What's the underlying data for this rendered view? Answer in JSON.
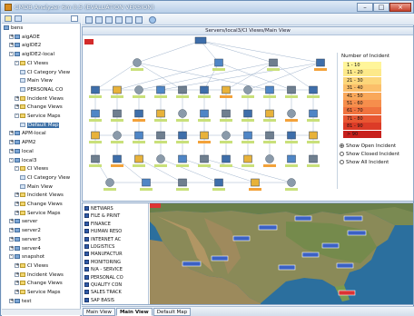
{
  "window": {
    "title": "CMDB Analyzer 6m 0.5 (EVALUATION VERSION)"
  },
  "tree": {
    "items": [
      {
        "label": "bens",
        "level": 0,
        "icon": "db",
        "expander": ""
      },
      {
        "label": "aigADE",
        "level": 1,
        "icon": "db",
        "expander": "+"
      },
      {
        "label": "aigIDE2",
        "level": 1,
        "icon": "db",
        "expander": "+"
      },
      {
        "label": "aigIDE2-local",
        "level": 1,
        "icon": "db",
        "expander": "-"
      },
      {
        "label": "CI Views",
        "level": 2,
        "icon": "fold",
        "expander": "-"
      },
      {
        "label": "CI Category View",
        "level": 3,
        "icon": "view",
        "expander": ""
      },
      {
        "label": "Main View",
        "level": 3,
        "icon": "view",
        "expander": ""
      },
      {
        "label": "PERSONAL CO",
        "level": 3,
        "icon": "view",
        "expander": ""
      },
      {
        "label": "Incident Views",
        "level": 2,
        "icon": "fold",
        "expander": "+"
      },
      {
        "label": "Change Views",
        "level": 2,
        "icon": "fold",
        "expander": "+"
      },
      {
        "label": "Service Maps",
        "level": 2,
        "icon": "fold",
        "expander": "-"
      },
      {
        "label": "Default Map",
        "level": 3,
        "icon": "view",
        "expander": "",
        "selected": true
      },
      {
        "label": "APM-local",
        "level": 1,
        "icon": "db",
        "expander": "+"
      },
      {
        "label": "APM2",
        "level": 1,
        "icon": "db",
        "expander": "+"
      },
      {
        "label": "local",
        "level": 1,
        "icon": "db",
        "expander": "+"
      },
      {
        "label": "local3",
        "level": 1,
        "icon": "db",
        "expander": "-"
      },
      {
        "label": "CI Views",
        "level": 2,
        "icon": "fold",
        "expander": "-"
      },
      {
        "label": "CI Category View",
        "level": 3,
        "icon": "view",
        "expander": ""
      },
      {
        "label": "Main View",
        "level": 3,
        "icon": "view",
        "expander": ""
      },
      {
        "label": "Incident Views",
        "level": 2,
        "icon": "fold",
        "expander": "+"
      },
      {
        "label": "Change Views",
        "level": 2,
        "icon": "fold",
        "expander": "+"
      },
      {
        "label": "Service Maps",
        "level": 2,
        "icon": "fold",
        "expander": "+"
      },
      {
        "label": "server",
        "level": 1,
        "icon": "db",
        "expander": "+"
      },
      {
        "label": "server2",
        "level": 1,
        "icon": "db",
        "expander": "+"
      },
      {
        "label": "server3",
        "level": 1,
        "icon": "db",
        "expander": "+"
      },
      {
        "label": "server4",
        "level": 1,
        "icon": "db",
        "expander": "+"
      },
      {
        "label": "snapshot",
        "level": 1,
        "icon": "db",
        "expander": "-"
      },
      {
        "label": "CI Views",
        "level": 2,
        "icon": "fold",
        "expander": "+"
      },
      {
        "label": "Incident Views",
        "level": 2,
        "icon": "fold",
        "expander": "+"
      },
      {
        "label": "Change Views",
        "level": 2,
        "icon": "fold",
        "expander": "+"
      },
      {
        "label": "Service Maps",
        "level": 2,
        "icon": "fold",
        "expander": "+"
      },
      {
        "label": "test",
        "level": 1,
        "icon": "db",
        "expander": "+"
      }
    ]
  },
  "graph": {
    "title": "Servers/local3/CI Views/Main View"
  },
  "legend": {
    "title": "Number of Incident",
    "ranges": [
      {
        "label": "1 - 10",
        "color": "#fff59a"
      },
      {
        "label": "11 - 20",
        "color": "#fde98a"
      },
      {
        "label": "21 - 30",
        "color": "#fcd67a"
      },
      {
        "label": "31 - 40",
        "color": "#fbbf6a"
      },
      {
        "label": "41 - 50",
        "color": "#f9a85a"
      },
      {
        "label": "51 - 60",
        "color": "#f68e4c"
      },
      {
        "label": "61 - 70",
        "color": "#f0733e"
      },
      {
        "label": "71 - 80",
        "color": "#e85732"
      },
      {
        "label": "81 - 90",
        "color": "#dc3b27"
      },
      {
        "label": "> 90",
        "color": "#c8201c"
      }
    ],
    "options": [
      {
        "label": "Show Open Incident",
        "checked": true
      },
      {
        "label": "Show Closed Incident",
        "checked": false
      },
      {
        "label": "Show All Incident",
        "checked": false
      }
    ]
  },
  "services": [
    "NETWARS",
    "FILE & PRINT",
    "FINANCE",
    "HUMAN RESO",
    "INTERNET AC",
    "LOGISTICS",
    "MANUFACTUR",
    "MONITORING",
    "N/A - SERVICE",
    "PERSONAL CO",
    "QUALITY CON",
    "SALES TRACK",
    "SAP BASIS"
  ],
  "tabs": [
    {
      "label": "Main View",
      "active": false
    },
    {
      "label": "Main View",
      "active": true
    },
    {
      "label": "Default Map",
      "active": false
    }
  ]
}
